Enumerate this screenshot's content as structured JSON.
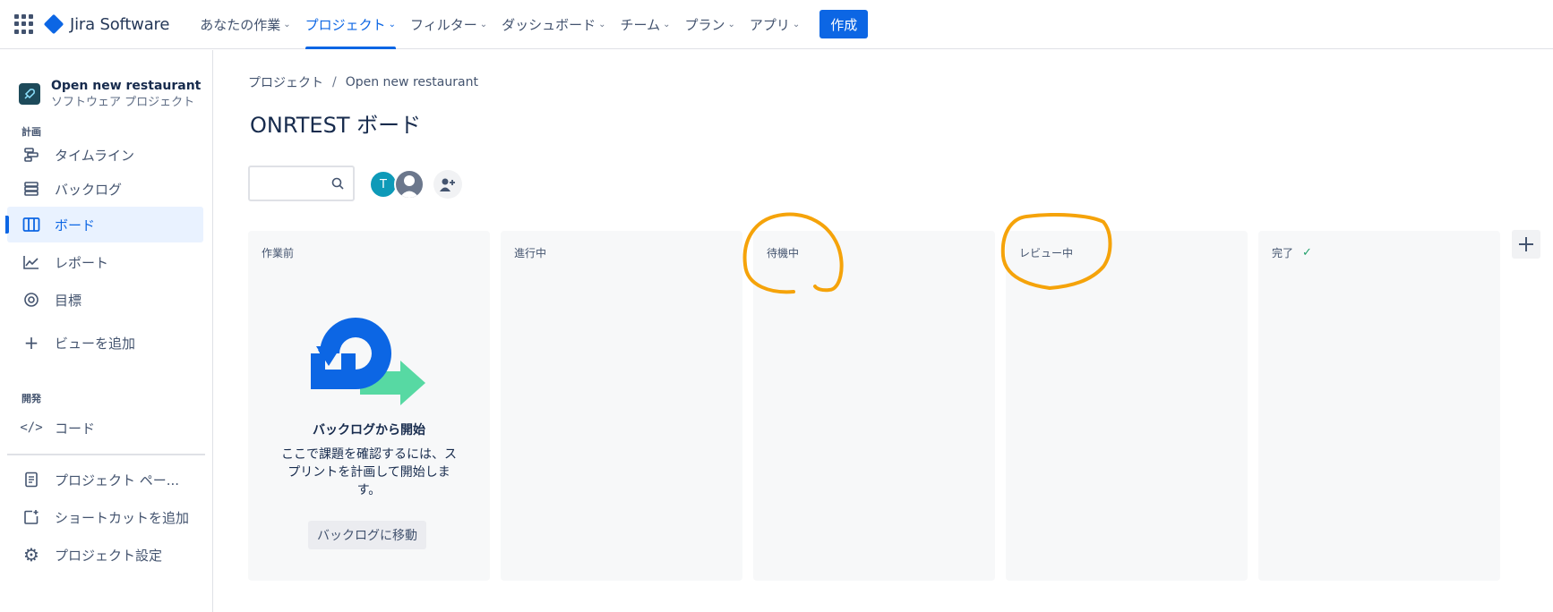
{
  "topnav": {
    "product": "Jira Software",
    "items": [
      {
        "label": "あなたの作業"
      },
      {
        "label": "プロジェクト"
      },
      {
        "label": "フィルター"
      },
      {
        "label": "ダッシュボード"
      },
      {
        "label": "チーム"
      },
      {
        "label": "プラン"
      },
      {
        "label": "アプリ"
      }
    ],
    "create_label": "作成"
  },
  "sidebar": {
    "project_name": "Open new restaurant",
    "project_type": "ソフトウェア プロジェクト",
    "section_plan": "計画",
    "section_dev": "開発",
    "items": [
      {
        "label": "タイムライン"
      },
      {
        "label": "バックログ"
      },
      {
        "label": "ボード"
      },
      {
        "label": "レポート"
      },
      {
        "label": "目標"
      },
      {
        "label": "ビューを追加"
      },
      {
        "label": "コード"
      },
      {
        "label": "プロジェクト ペー..."
      },
      {
        "label": "ショートカットを追加"
      },
      {
        "label": "プロジェクト設定"
      }
    ]
  },
  "breadcrumb": {
    "root": "プロジェクト",
    "sep": "/",
    "current": "Open new restaurant"
  },
  "page_title": "ONRTEST ボード",
  "search": {
    "value": "",
    "placeholder": ""
  },
  "avatar_initial": "T",
  "columns": [
    {
      "title": "作業前"
    },
    {
      "title": "進行中"
    },
    {
      "title": "待機中"
    },
    {
      "title": "レビュー中"
    },
    {
      "title": "完了"
    }
  ],
  "empty_state": {
    "title": "バックログから開始",
    "description": "ここで課題を確認するには、スプリントを計画して開始します。",
    "button": "バックログに移動"
  },
  "colors": {
    "accent": "#0c66e4",
    "annotation": "#f5a30a",
    "done_check": "#22a06b"
  }
}
